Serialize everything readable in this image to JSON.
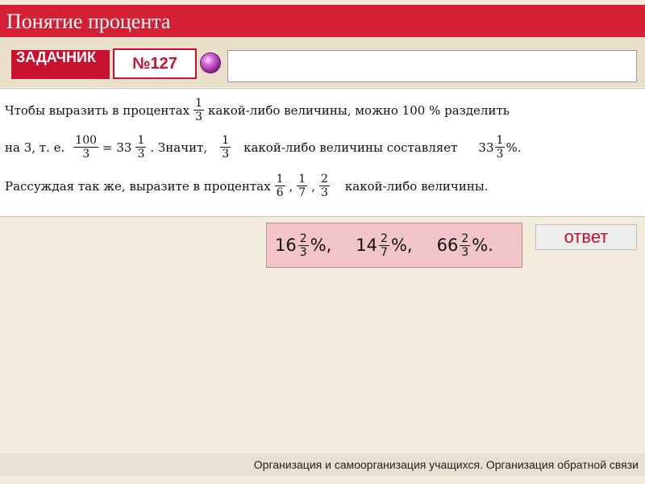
{
  "slide": {
    "title": "Понятие процента"
  },
  "toolbar": {
    "badge_label": "ЗАДАЧНИК",
    "task_number": "№127",
    "answer_value": ""
  },
  "problem": {
    "line1": {
      "p1": "Чтобы выразить в процентах",
      "f1_num": "1",
      "f1_den": "3",
      "p2": "какой-либо величины, можно 100 % разделить"
    },
    "line2": {
      "p1": "на 3,  т. е.",
      "f1_num": "100",
      "f1_den": "3",
      "p2": "= 33",
      "f2_num": "1",
      "f2_den": "3",
      "p3": ".  Значит,",
      "f3_num": "1",
      "f3_den": "3",
      "p4": "какой-либо величины составляет",
      "p5": "33",
      "f4_num": "1",
      "f4_den": "3",
      "p6": "%."
    },
    "line3": {
      "p1": "Рассуждая так же, выразите в процентах",
      "f1_num": "1",
      "f1_den": "6",
      "sep1": ",",
      "f2_num": "1",
      "f2_den": "7",
      "sep2": ",",
      "f3_num": "2",
      "f3_den": "3",
      "p2": "какой-либо величины."
    }
  },
  "answer": {
    "a1": {
      "whole": "16",
      "num": "2",
      "den": "3",
      "suffix": "%,"
    },
    "a2": {
      "whole": "14",
      "num": "2",
      "den": "7",
      "suffix": "%,"
    },
    "a3": {
      "whole": "66",
      "num": "2",
      "den": "3",
      "suffix": "%."
    }
  },
  "reveal_button": {
    "label": "ответ"
  },
  "footer": {
    "text": "Организация и самоорганизация учащихся. Организация обратной связи"
  }
}
